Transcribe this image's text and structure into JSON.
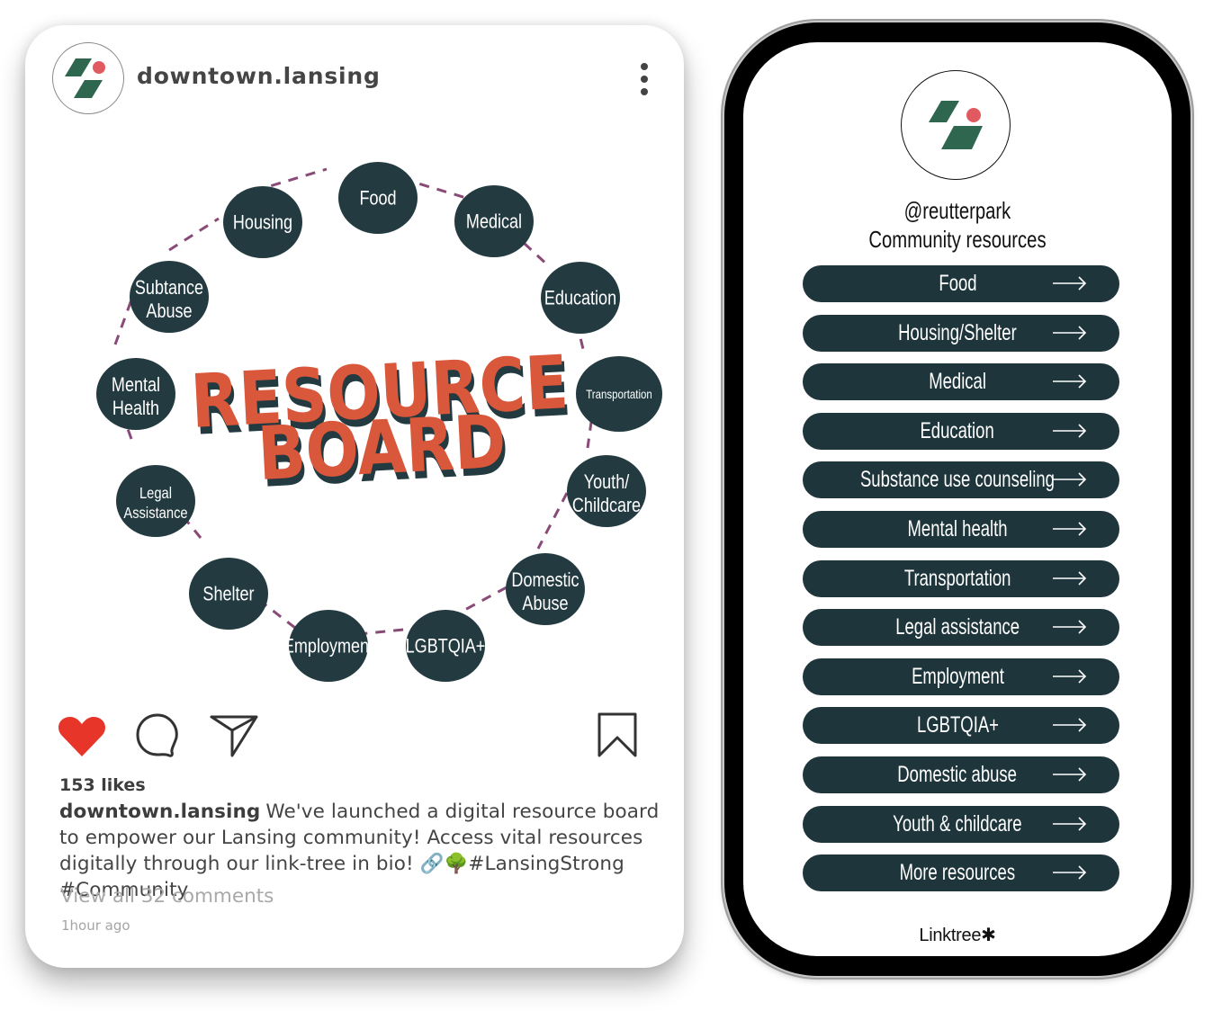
{
  "colors": {
    "brand_green": "#2e6650",
    "brand_red": "#e05a5f",
    "bubble": "#223a40",
    "title_orange": "#d9573a",
    "dash_purple": "#8a4a78",
    "heart_red": "#e8352a",
    "linktree_button": "#1e353b"
  },
  "instagram_post": {
    "username": "downtown.lansing",
    "more_icon": "more-vertical-icon",
    "graphic": {
      "title_line1": "RESOURCE",
      "title_line2": "BOARD",
      "bubbles": [
        {
          "label": "Food"
        },
        {
          "label": "Medical"
        },
        {
          "label": "Education"
        },
        {
          "label": "Transportation"
        },
        {
          "label": "Youth/",
          "label2": "Childcare"
        },
        {
          "label": "Domestic",
          "label2": "Abuse"
        },
        {
          "label": "LGBTQIA+"
        },
        {
          "label": "Employment"
        },
        {
          "label": "Shelter"
        },
        {
          "label": "Legal",
          "label2": "Assistance"
        },
        {
          "label": "Mental",
          "label2": "Health"
        },
        {
          "label": "Subtance",
          "label2": "Abuse"
        },
        {
          "label": "Housing"
        }
      ]
    },
    "actions": {
      "like_icon": "heart-filled-icon",
      "comment_icon": "comment-bubble-icon",
      "share_icon": "paper-plane-icon",
      "save_icon": "bookmark-icon"
    },
    "likes": "153 likes",
    "caption_username": "downtown.lansing",
    "caption_text": "We've launched a digital resource board to empower our Lansing community! Access vital resources digitally through our link-tree in bio! 🔗🌳#LansingStrong #Community",
    "view_comments": "View all 32 comments",
    "timestamp": "1hour ago"
  },
  "linktree": {
    "handle": "@reutterpark",
    "subtitle": "Community resources",
    "buttons": [
      {
        "label": "Food"
      },
      {
        "label": "Housing/Shelter"
      },
      {
        "label": "Medical"
      },
      {
        "label": "Education"
      },
      {
        "label": "Substance use counseling"
      },
      {
        "label": "Mental health"
      },
      {
        "label": "Transportation"
      },
      {
        "label": "Legal assistance"
      },
      {
        "label": "Employment"
      },
      {
        "label": "LGBTQIA+"
      },
      {
        "label": "Domestic abuse"
      },
      {
        "label": "Youth & childcare"
      },
      {
        "label": "More resources"
      }
    ],
    "arrow_icon": "arrow-right-icon",
    "brand": "Linktree✱"
  }
}
